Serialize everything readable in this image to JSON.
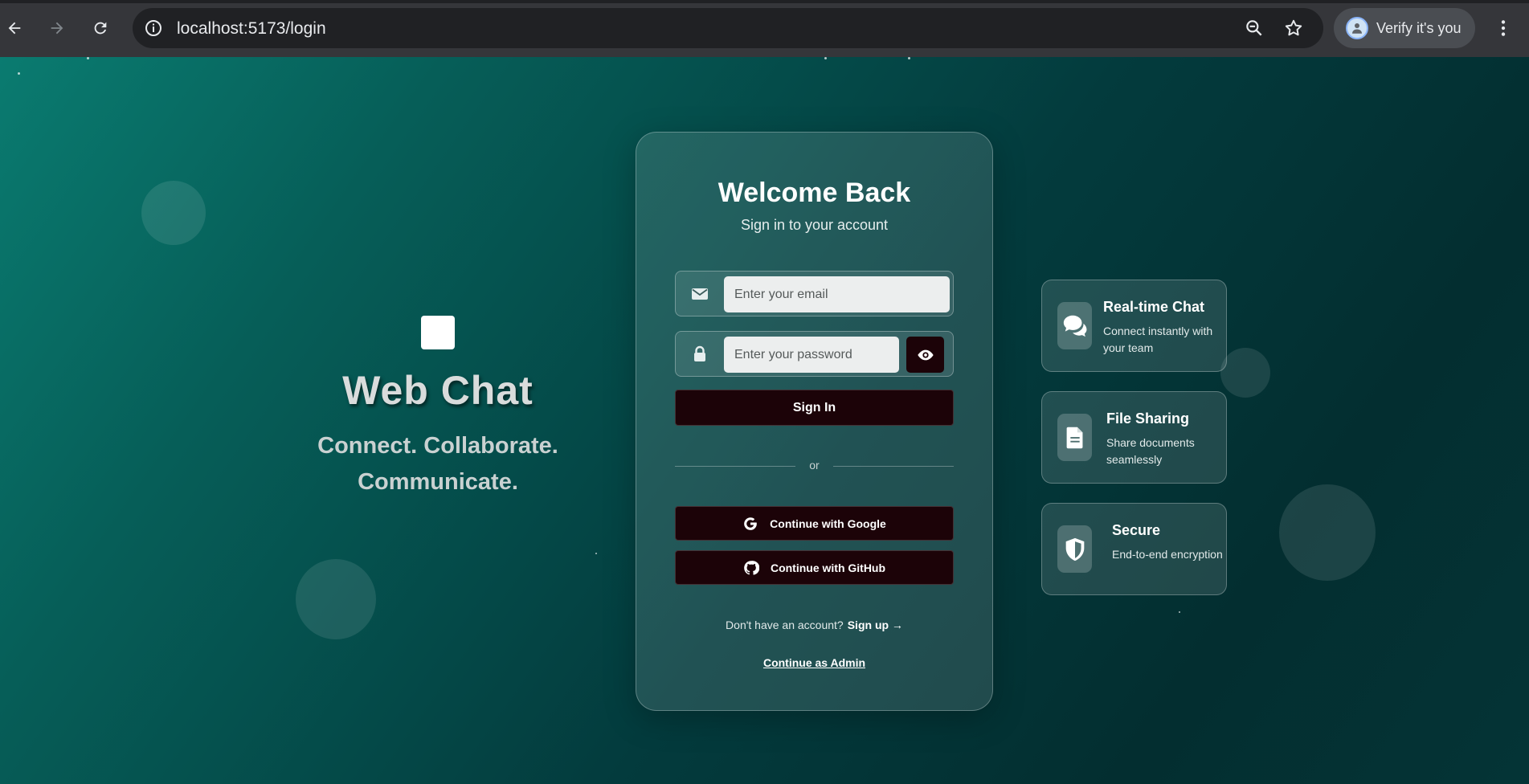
{
  "browser": {
    "url": "localhost:5173/login",
    "profile_label": "Verify it's you"
  },
  "brand": {
    "title": "Web Chat",
    "tagline_line1": "Connect. Collaborate.",
    "tagline_line2": "Communicate."
  },
  "login": {
    "title": "Welcome Back",
    "subtitle": "Sign in to your account",
    "email_placeholder": "Enter your email",
    "password_placeholder": "Enter your password",
    "signin_label": "Sign In",
    "divider_label": "or",
    "google_label": "Continue with Google",
    "github_label": "Continue with GitHub",
    "signup_prompt": "Don't have an account?",
    "signup_link": "Sign up →",
    "admin_link": "Continue as Admin"
  },
  "features": [
    {
      "title": "Real-time Chat",
      "description": "Connect instantly with your team",
      "icon": "chat-bubbles-icon"
    },
    {
      "title": "File Sharing",
      "description": "Share documents seamlessly",
      "icon": "document-icon"
    },
    {
      "title": "Secure",
      "description": "End-to-end encryption",
      "icon": "shield-icon"
    }
  ],
  "colors": {
    "button_dark": "#1c0308",
    "page_gradient_start": "#0a7b70",
    "page_gradient_end": "#032e30"
  }
}
